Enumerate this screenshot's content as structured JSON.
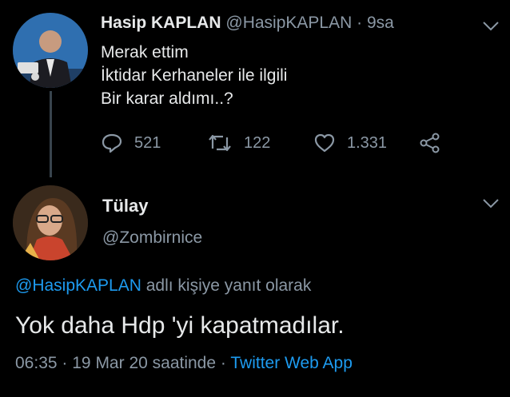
{
  "first_tweet": {
    "author_name": "Hasip KAPLAN",
    "author_handle": "@HasipKAPLAN",
    "time_sep": "·",
    "time": "9sa",
    "text_lines": [
      "Merak ettim",
      "İktidar Kerhaneler ile ilgili",
      "Bir karar aldımı..?"
    ],
    "actions": {
      "reply_count": "521",
      "retweet_count": "122",
      "like_count": "1.331"
    }
  },
  "reply_tweet": {
    "author_name": "Tülay",
    "author_handle": "@Zombirnice",
    "reply_to_handle": "@HasipKAPLAN",
    "reply_to_suffix": "adlı kişiye yanıt olarak",
    "text": "Yok daha Hdp 'yi kapatmadılar.",
    "time": "06:35",
    "sep1": "·",
    "date": "19 Mar 20 saatinde",
    "sep2": "·",
    "source": "Twitter Web App"
  },
  "icons": [
    "reply-icon",
    "retweet-icon",
    "like-icon",
    "share-icon",
    "chevron-down-icon"
  ],
  "colors": {
    "background": "#000000",
    "text": "#e7e9ea",
    "muted": "#8b98a5",
    "link": "#1d9bf0"
  }
}
